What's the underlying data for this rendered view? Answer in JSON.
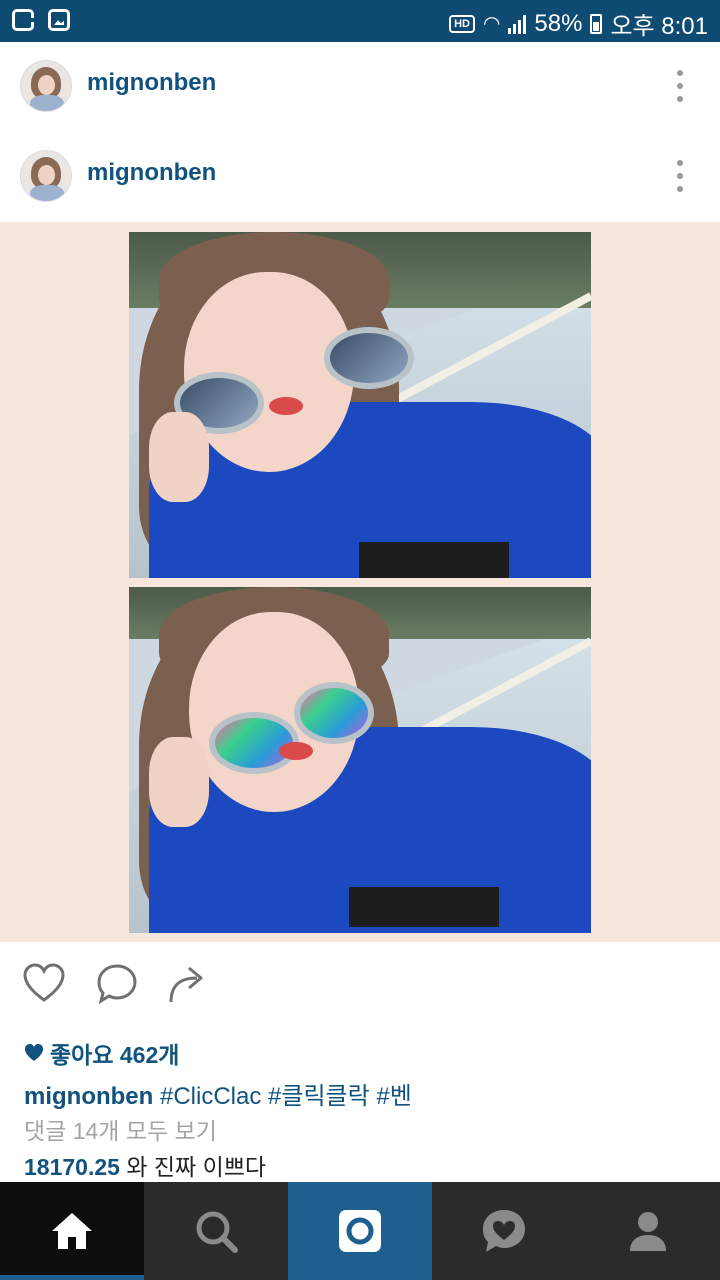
{
  "status_bar": {
    "battery": "58%",
    "time": "오후 8:01",
    "hd_label": "HD"
  },
  "posts": [
    {
      "username": "mignonben"
    },
    {
      "username": "mignonben"
    }
  ],
  "feed": {
    "likes_text": "좋아요 462개",
    "caption_user": "mignonben",
    "caption_tags": [
      "#ClicClac",
      "#클릭클락",
      "#벤"
    ],
    "view_comments": "댓글 14개 모두 보기",
    "comment_user": "18170.25",
    "comment_text": "와 진짜 이쁘다"
  },
  "colors": {
    "brand": "#12527e",
    "status_bar": "#0f4a73",
    "nav_active": "#1e5f8f"
  },
  "icons": {
    "actions": [
      "heart-icon",
      "comment-icon",
      "share-icon"
    ],
    "nav": [
      "home-icon",
      "search-icon",
      "camera-icon",
      "activity-icon",
      "profile-icon"
    ]
  }
}
